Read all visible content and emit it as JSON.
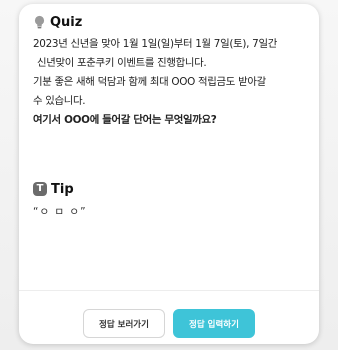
{
  "quiz": {
    "title": "Quiz",
    "icon": "lightbulb-icon",
    "lines": [
      "2023년 신년을 맞아 1월 1일(일)부터 1월 7일(토), 7일간",
      "신년맞이 포춘쿠키 이벤트를 진행합니다.",
      "기분 좋은 새해 덕담과 함께 최대 OOO 적립금도 받아갈",
      "수 있습니다.",
      "여기서 OOO에 들어갈 단어는 무엇일까요?"
    ]
  },
  "tip": {
    "title": "Tip",
    "icon_glyph": "T",
    "icon": "tip-icon",
    "hint": "“ㅇ ㅁ ㅇ”"
  },
  "buttons": {
    "show_answer": "정답 보러가기",
    "enter_answer": "정답 입력하기"
  },
  "colors": {
    "primary": "#3ec4d8",
    "tip_icon_bg": "#6b6b6b"
  }
}
